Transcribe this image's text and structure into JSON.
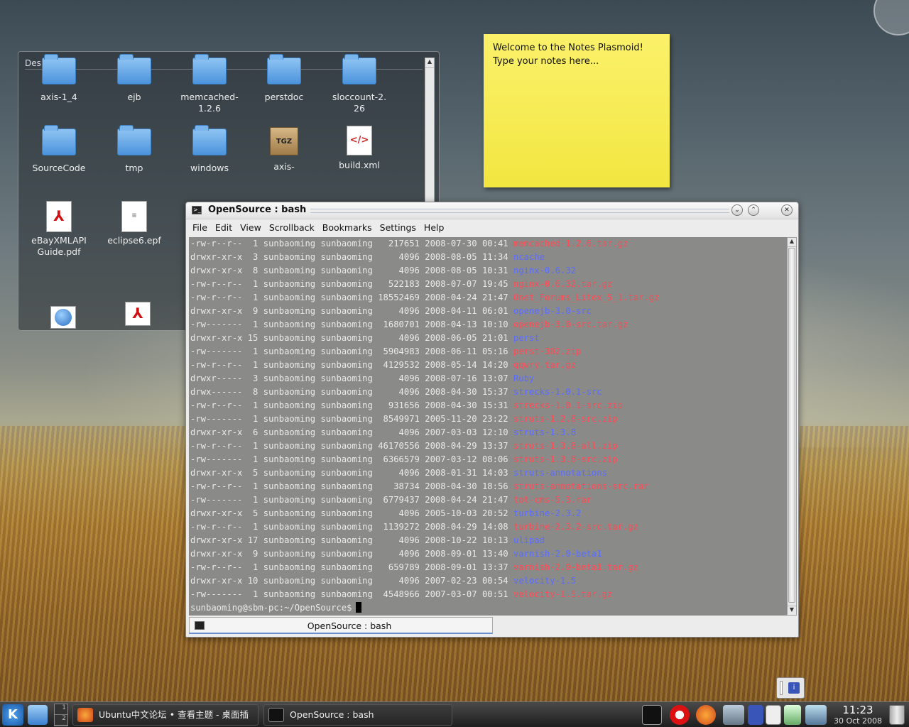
{
  "desktop": {
    "folderview": {
      "title": "Desktop",
      "icons": [
        {
          "label": "axis-1_4",
          "type": "folder"
        },
        {
          "label": "ejb",
          "type": "folder"
        },
        {
          "label": "memcached-1.2.6",
          "type": "folder"
        },
        {
          "label": "perstdoc",
          "type": "folder"
        },
        {
          "label": "sloccount-2.26",
          "type": "folder"
        },
        {
          "label": "SourceCode",
          "type": "folder"
        },
        {
          "label": "tmp",
          "type": "folder"
        },
        {
          "label": "windows",
          "type": "folder"
        },
        {
          "label": "axis-",
          "type": "archive",
          "glyph": "TGZ"
        },
        {
          "label": "build.xml",
          "type": "xml",
          "glyph": "</>"
        },
        {
          "label": "eBayXMLAPIGuide.pdf",
          "type": "pdf"
        },
        {
          "label": "eclipse6.epf",
          "type": "text"
        }
      ]
    },
    "notes": {
      "line1": "Welcome to the Notes Plasmoid!",
      "line2": "Type your notes here..."
    }
  },
  "konsole": {
    "title": "OpenSource : bash",
    "menu": [
      "File",
      "Edit",
      "View",
      "Scrollback",
      "Bookmarks",
      "Settings",
      "Help"
    ],
    "listing": [
      {
        "perm": "-rw-r--r--",
        "links": "1",
        "user": "sunbaoming",
        "group": "sunbaoming",
        "size": "217651",
        "date": "2008-07-30",
        "time": "00:41",
        "name": "memcached-1.2.6.tar.gz",
        "kind": "archive"
      },
      {
        "perm": "drwxr-xr-x",
        "links": "3",
        "user": "sunbaoming",
        "group": "sunbaoming",
        "size": "4096",
        "date": "2008-08-05",
        "time": "11:34",
        "name": "ncache",
        "kind": "dir"
      },
      {
        "perm": "drwxr-xr-x",
        "links": "8",
        "user": "sunbaoming",
        "group": "sunbaoming",
        "size": "4096",
        "date": "2008-08-05",
        "time": "10:31",
        "name": "nginx-0.6.32",
        "kind": "dir"
      },
      {
        "perm": "-rw-r--r--",
        "links": "1",
        "user": "sunbaoming",
        "group": "sunbaoming",
        "size": "522183",
        "date": "2008-07-07",
        "time": "19:45",
        "name": "nginx-0.6.32.tar.gz",
        "kind": "archive"
      },
      {
        "perm": "-rw-r--r--",
        "links": "1",
        "user": "sunbaoming",
        "group": "sunbaoming",
        "size": "18552469",
        "date": "2008-04-24",
        "time": "21:47",
        "name": "Onet_Forums_Litex_5_1.tar.gz",
        "kind": "archive"
      },
      {
        "perm": "drwxr-xr-x",
        "links": "9",
        "user": "sunbaoming",
        "group": "sunbaoming",
        "size": "4096",
        "date": "2008-04-11",
        "time": "06:01",
        "name": "openejb-3.0-src",
        "kind": "dir"
      },
      {
        "perm": "-rw-------",
        "links": "1",
        "user": "sunbaoming",
        "group": "sunbaoming",
        "size": "1680701",
        "date": "2008-04-13",
        "time": "10:10",
        "name": "openejb-3.0-src.tar.gz",
        "kind": "archive"
      },
      {
        "perm": "drwxr-xr-x",
        "links": "15",
        "user": "sunbaoming",
        "group": "sunbaoming",
        "size": "4096",
        "date": "2008-06-05",
        "time": "21:01",
        "name": "perst",
        "kind": "dir"
      },
      {
        "perm": "-rw-------",
        "links": "1",
        "user": "sunbaoming",
        "group": "sunbaoming",
        "size": "5904983",
        "date": "2008-06-11",
        "time": "05:16",
        "name": "perst-302.zip",
        "kind": "archive"
      },
      {
        "perm": "-rw-r--r--",
        "links": "1",
        "user": "sunbaoming",
        "group": "sunbaoming",
        "size": "4129532",
        "date": "2008-05-14",
        "time": "14:20",
        "name": "qqwry.tar.gz",
        "kind": "archive"
      },
      {
        "perm": "drwxr-----",
        "links": "3",
        "user": "sunbaoming",
        "group": "sunbaoming",
        "size": "4096",
        "date": "2008-07-16",
        "time": "13:07",
        "name": "Ruby",
        "kind": "dir"
      },
      {
        "perm": "drwx------",
        "links": "8",
        "user": "sunbaoming",
        "group": "sunbaoming",
        "size": "4096",
        "date": "2008-04-30",
        "time": "15:37",
        "name": "strecks-1.0.1-src",
        "kind": "dir"
      },
      {
        "perm": "-rw-r--r--",
        "links": "1",
        "user": "sunbaoming",
        "group": "sunbaoming",
        "size": "931656",
        "date": "2008-04-30",
        "time": "15:31",
        "name": "strecks-1.0.1-src.zip",
        "kind": "archive"
      },
      {
        "perm": "-rw-------",
        "links": "1",
        "user": "sunbaoming",
        "group": "sunbaoming",
        "size": "8549971",
        "date": "2005-11-20",
        "time": "23:22",
        "name": "struts-1.2.8-src.zip",
        "kind": "archive"
      },
      {
        "perm": "drwxr-xr-x",
        "links": "6",
        "user": "sunbaoming",
        "group": "sunbaoming",
        "size": "4096",
        "date": "2007-03-03",
        "time": "12:10",
        "name": "struts-1.3.8",
        "kind": "dir"
      },
      {
        "perm": "-rw-r--r--",
        "links": "1",
        "user": "sunbaoming",
        "group": "sunbaoming",
        "size": "46170556",
        "date": "2008-04-29",
        "time": "13:37",
        "name": "struts-1.3.8-all.zip",
        "kind": "archive"
      },
      {
        "perm": "-rw-------",
        "links": "1",
        "user": "sunbaoming",
        "group": "sunbaoming",
        "size": "6366579",
        "date": "2007-03-12",
        "time": "08:06",
        "name": "struts-1.3.8-src.zip",
        "kind": "archive"
      },
      {
        "perm": "drwxr-xr-x",
        "links": "5",
        "user": "sunbaoming",
        "group": "sunbaoming",
        "size": "4096",
        "date": "2008-01-31",
        "time": "14:03",
        "name": "struts-annotations",
        "kind": "dir"
      },
      {
        "perm": "-rw-r--r--",
        "links": "1",
        "user": "sunbaoming",
        "group": "sunbaoming",
        "size": "38734",
        "date": "2008-04-30",
        "time": "18:56",
        "name": "struts-annotations-src.rar",
        "kind": "archive"
      },
      {
        "perm": "-rw-------",
        "links": "1",
        "user": "sunbaoming",
        "group": "sunbaoming",
        "size": "6779437",
        "date": "2008-04-24",
        "time": "21:47",
        "name": "tot-cms-5.3.rar",
        "kind": "archive"
      },
      {
        "perm": "drwxr-xr-x",
        "links": "5",
        "user": "sunbaoming",
        "group": "sunbaoming",
        "size": "4096",
        "date": "2005-10-03",
        "time": "20:52",
        "name": "turbine-2.3.2",
        "kind": "dir"
      },
      {
        "perm": "-rw-r--r--",
        "links": "1",
        "user": "sunbaoming",
        "group": "sunbaoming",
        "size": "1139272",
        "date": "2008-04-29",
        "time": "14:08",
        "name": "turbine-2.3.2-src.tar.gz",
        "kind": "archive"
      },
      {
        "perm": "drwxr-xr-x",
        "links": "17",
        "user": "sunbaoming",
        "group": "sunbaoming",
        "size": "4096",
        "date": "2008-10-22",
        "time": "10:13",
        "name": "ulipad",
        "kind": "dir"
      },
      {
        "perm": "drwxr-xr-x",
        "links": "9",
        "user": "sunbaoming",
        "group": "sunbaoming",
        "size": "4096",
        "date": "2008-09-01",
        "time": "13:40",
        "name": "varnish-2.0-beta1",
        "kind": "dir"
      },
      {
        "perm": "-rw-r--r--",
        "links": "1",
        "user": "sunbaoming",
        "group": "sunbaoming",
        "size": "659789",
        "date": "2008-09-01",
        "time": "13:37",
        "name": "varnish-2.0-beta1.tar.gz",
        "kind": "archive"
      },
      {
        "perm": "drwxr-xr-x",
        "links": "10",
        "user": "sunbaoming",
        "group": "sunbaoming",
        "size": "4096",
        "date": "2007-02-23",
        "time": "00:54",
        "name": "velocity-1.5",
        "kind": "dir"
      },
      {
        "perm": "-rw-------",
        "links": "1",
        "user": "sunbaoming",
        "group": "sunbaoming",
        "size": "4548966",
        "date": "2007-03-07",
        "time": "00:51",
        "name": "velocity-1.5.tar.gz",
        "kind": "archive"
      }
    ],
    "prompt": "sunbaoming@sbm-pc:~/OpenSource$",
    "tab_label": "OpenSource : bash",
    "colors": {
      "dir": "#5a6cff",
      "archive": "#ff4a55"
    }
  },
  "taskbar": {
    "kmenu_glyph": "K",
    "pager": [
      "1",
      "2"
    ],
    "tasks": [
      {
        "label": "Ubuntu中文论坛 • 查看主题 - 桌面插"
      },
      {
        "label": "OpenSource : bash"
      }
    ],
    "clock": {
      "time": "11:23",
      "date": "30 Oct 2008"
    }
  }
}
